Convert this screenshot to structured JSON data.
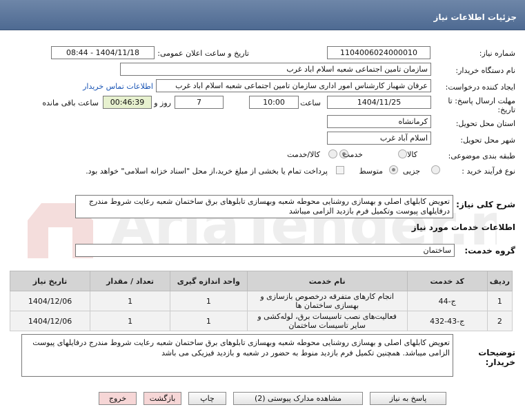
{
  "header": {
    "title": "جزئیات اطلاعات نیاز"
  },
  "form": {
    "need_number_label": "شماره نیاز:",
    "need_number": "1104006024000010",
    "announce_label": "تاریخ و ساعت اعلان عمومی:",
    "announce_value": "1404/11/18 - 08:44",
    "buyer_org_label": "نام دستگاه خریدار:",
    "buyer_org": "سازمان تامین اجتماعی شعبه اسلام اباد غرب",
    "creator_label": "ایجاد کننده درخواست:",
    "creator": "عرفان شهباز کارشناس امور اداری سازمان تامین اجتماعی شعبه اسلام اباد غرب",
    "contact_link": "اطلاعات تماس خریدار",
    "deadline_label_1": "مهلت ارسال پاسخ: تا",
    "deadline_label_2": "تاریخ:",
    "deadline_date": "1404/11/25",
    "time_label": "ساعت",
    "deadline_time": "10:00",
    "days_value": "7",
    "days_label": "روز و",
    "remaining_value": "00:46:39",
    "remaining_label": "ساعت باقی مانده",
    "province_label": "استان محل تحویل:",
    "province": "کرمانشاه",
    "city_label": "شهر محل تحویل:",
    "city": "اسلام آباد غرب",
    "category_label": "طبقه بندی موضوعی:",
    "category_options": [
      "کالا",
      "خدمت",
      "کالا/خدمت"
    ],
    "category_selected": "خدمت",
    "process_label": "نوع فرآیند خرید :",
    "process_options": [
      "جزیی",
      "متوسط"
    ],
    "process_selected": "متوسط",
    "payment_note": "پرداخت تمام یا بخشی از مبلغ خرید،از محل \"اسناد خزانه اسلامی\" خواهد بود."
  },
  "summary": {
    "label": "شرح کلی نیاز:",
    "text": "تعویض کابلهای اصلی و بهسازی روشنایی محوطه شعبه وبهسازی تابلوهای برق ساختمان شعبه رعایت شروط مندرج درفایلهای پیوست وتکمیل فرم بازدید الزامی میباشد"
  },
  "services": {
    "section_title": "اطلاعات خدمات مورد نیاز",
    "group_label": "گروه خدمت:",
    "group_value": "ساختمان",
    "columns": [
      "ردیف",
      "کد خدمت",
      "نام خدمت",
      "واحد اندازه گیری",
      "تعداد / مقدار",
      "تاریخ نیاز"
    ],
    "rows": [
      {
        "row": "1",
        "code": "ج-44",
        "name": "انجام کارهای متفرقه درخصوص بازسازی و بهسازی ساختمان ها",
        "unit": "1",
        "qty": "1",
        "date": "1404/12/06"
      },
      {
        "row": "2",
        "code": "ج-43-432",
        "name": "فعالیت‌های نصب تاسیسات برق، لوله‌کشی و سایر تاسیسات ساختمان",
        "unit": "1",
        "qty": "1",
        "date": "1404/12/06"
      }
    ]
  },
  "buyer_notes": {
    "label": "توضیحات خریدار:",
    "text": "تعویض کابلهای اصلی و بهسازی روشنایی محوطه شعبه وبهسازی تابلوهای برق ساختمان شعبه رعایت شروط مندرج درفایلهای پیوست الزامی میباشد. همچنین تکمیل فرم بازدید منوط به حضور در شعبه و بازدید فیزیکی می باشد"
  },
  "buttons": {
    "reply": "پاسخ به نیاز",
    "docs": "مشاهده مدارک پیوستی (2)",
    "print": "چاپ",
    "back": "بازگشت",
    "exit": "خروج"
  },
  "watermark": {
    "text": "AriaTender.net"
  }
}
